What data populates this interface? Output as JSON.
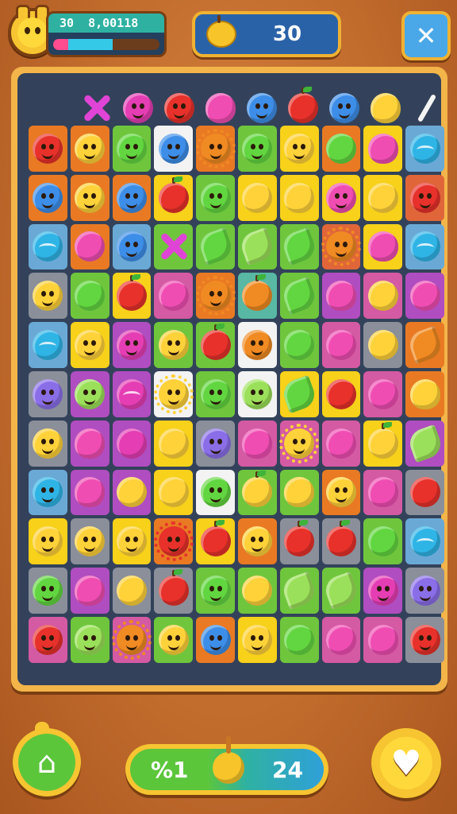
{
  "hud": {
    "level_value": "30",
    "score_text": "8,00118",
    "progress_fraction": 0.56,
    "coin_count": "30",
    "close_icon": "close-x-icon"
  },
  "top_row": [
    "x-candy",
    "pink-blob",
    "red-wink",
    "pink-heart",
    "blue-blob",
    "red-apple",
    "blue-face",
    "yellow-heart",
    "white-slash"
  ],
  "palette": {
    "cell": {
      "o": "#e97a23",
      "y": "#f7d11a",
      "g": "#6fc63d",
      "p": "#b04dc0",
      "b": "#6aa9d6",
      "w": "#f3f3f3",
      "r": "#e0663a",
      "m": "#d45aa3",
      "t": "#58b8a3",
      "n": "#8a8f9a"
    },
    "piece": {
      "R": "#e8312b",
      "Y": "#ffd23a",
      "G": "#62d640",
      "B": "#3d8ee8",
      "P": "#f04db3",
      "O": "#f08a22",
      "L": "#9be05a",
      "V": "#8a6ee8",
      "C": "#2fb4e6",
      "M": "#e53eb4"
    }
  },
  "grid": [
    [
      "o:R:face",
      "o:Y:face",
      "g:G:face",
      "w:B:ears",
      "o:O:spiky",
      "g:G:face",
      "y:Y:face",
      "o:G:plain",
      "y:P:heart",
      "b:C:swirl"
    ],
    [
      "o:B:ears",
      "o:Y:face",
      "o:B:ears",
      "y:R:apple",
      "g:G:ears",
      "y:Y:plain",
      "y:Y:heart",
      "y:P:ears",
      "y:Y:plain",
      "r:R:face"
    ],
    [
      "b:C:swirl",
      "o:P:plain",
      "b:B:face",
      "g:X:x",
      "g:G:leaf",
      "g:L:leaf",
      "g:G:leaf",
      "r:O:spiky",
      "y:P:heart",
      "b:C:swirl"
    ],
    [
      "n:Y:ears",
      "g:G:plain",
      "y:R:apple",
      "m:P:plain",
      "o:O:spiky",
      "t:O:apple",
      "g:G:leaf",
      "p:P:heart",
      "m:Y:plain",
      "p:P:plain"
    ],
    [
      "b:C:swirl",
      "y:Y:ears",
      "p:M:face",
      "g:Y:face",
      "g:R:apple",
      "w:O:ears",
      "g:G:plain",
      "m:P:plain",
      "n:Y:plain",
      "o:O:leaf"
    ],
    [
      "n:V:face",
      "p:L:ears",
      "p:M:swirl",
      "w:Y:spiky",
      "g:G:ears",
      "w:L:face",
      "y:G:leaf",
      "y:R:plain",
      "m:P:plain",
      "o:Y:heart"
    ],
    [
      "n:Y:ears",
      "p:P:heart",
      "p:M:plain",
      "y:Y:plain",
      "n:V:face",
      "m:P:heart",
      "m:Y:spiky",
      "m:P:plain",
      "y:Y:apple",
      "p:L:leaf"
    ],
    [
      "b:C:ears",
      "p:P:heart",
      "p:Y:plain",
      "y:Y:plain",
      "w:G:ears",
      "g:Y:apple",
      "g:Y:heart",
      "o:Y:ears",
      "m:P:heart",
      "n:R:plain"
    ],
    [
      "y:Y:face",
      "n:Y:face",
      "y:Y:ears",
      "o:R:spiky",
      "y:R:apple",
      "o:Y:ears",
      "n:R:apple",
      "n:R:apple",
      "g:G:plain",
      "b:C:swirl"
    ],
    [
      "n:G:face",
      "p:P:heart",
      "n:Y:plain",
      "n:R:apple",
      "g:G:face",
      "g:Y:plain",
      "g:L:leaf",
      "g:L:leaf",
      "p:M:ears",
      "n:V:face"
    ],
    [
      "m:R:face",
      "g:L:face",
      "m:O:spiky",
      "g:Y:face",
      "o:B:ears",
      "y:Y:ears",
      "g:G:plain",
      "m:P:plain",
      "m:P:heart",
      "n:R:face"
    ]
  ],
  "bottom": {
    "home_icon": "home-icon",
    "moves_left": "%1",
    "moves_right": "24",
    "heart_icon": "heart-icon"
  }
}
